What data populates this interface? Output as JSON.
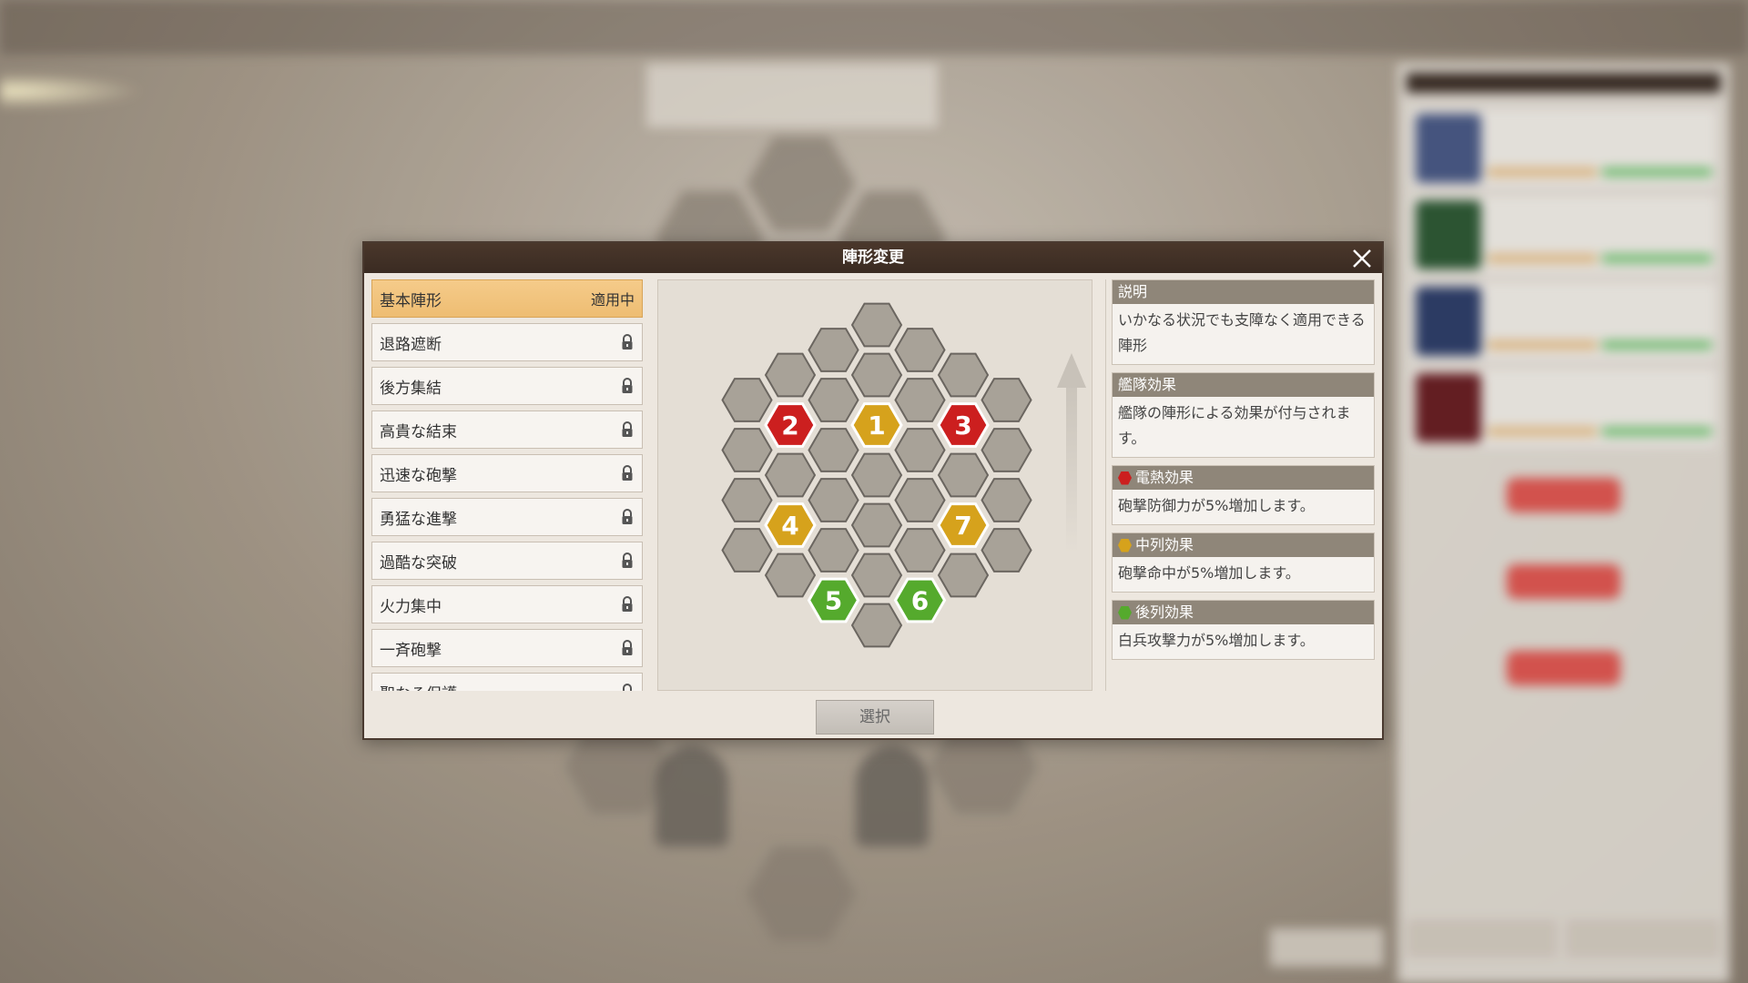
{
  "dialog": {
    "title": "陣形変更",
    "select_label": "選択"
  },
  "formations": [
    {
      "label": "基本陣形",
      "status": "適用中",
      "active": true,
      "locked": false
    },
    {
      "label": "退路遮断",
      "locked": true
    },
    {
      "label": "後方集結",
      "locked": true
    },
    {
      "label": "高貴な結束",
      "locked": true
    },
    {
      "label": "迅速な砲撃",
      "locked": true
    },
    {
      "label": "勇猛な進撃",
      "locked": true
    },
    {
      "label": "過酷な突破",
      "locked": true
    },
    {
      "label": "火力集中",
      "locked": true
    },
    {
      "label": "一斉砲撃",
      "locked": true
    },
    {
      "label": "聖なる保護",
      "locked": true
    }
  ],
  "board": {
    "slots": [
      {
        "number": "1",
        "color": "#d6a21c"
      },
      {
        "number": "2",
        "color": "#cc1f1f"
      },
      {
        "number": "3",
        "color": "#cc1f1f"
      },
      {
        "number": "4",
        "color": "#d6a21c"
      },
      {
        "number": "5",
        "color": "#55aa2d"
      },
      {
        "number": "6",
        "color": "#55aa2d"
      },
      {
        "number": "7",
        "color": "#d6a21c"
      }
    ],
    "empty_color": "#a8a298",
    "direction_icon": "arrow-up-icon"
  },
  "info": {
    "description": {
      "title": "説明",
      "text": "いかなる状況でも支障なく適用できる陣形"
    },
    "fleet_effect": {
      "title": "艦隊効果",
      "text": "艦隊の陣形による効果が付与されます。"
    },
    "effects": [
      {
        "title": "電熱効果",
        "text": "砲撃防御力が5%増加します。",
        "color": "#cc1f1f"
      },
      {
        "title": "中列効果",
        "text": "砲撃命中が5%増加します。",
        "color": "#d6a21c"
      },
      {
        "title": "後列効果",
        "text": "白兵攻撃力が5%増加します。",
        "color": "#55aa2d"
      }
    ]
  }
}
